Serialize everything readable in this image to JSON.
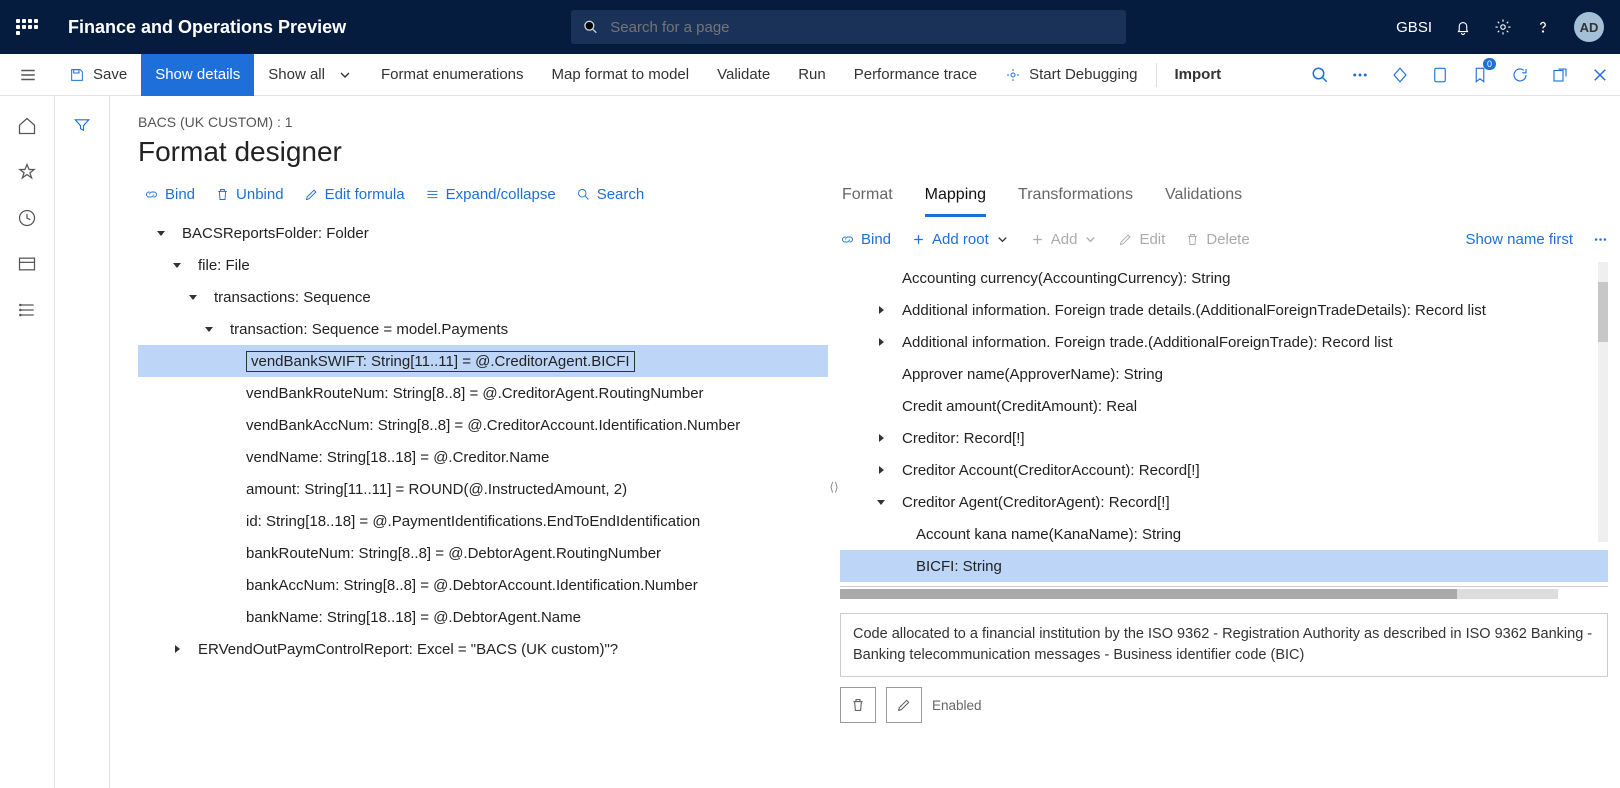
{
  "header": {
    "app_title": "Finance and Operations Preview",
    "search_placeholder": "Search for a page",
    "company": "GBSI",
    "avatar": "AD"
  },
  "cmdbar": {
    "save": "Save",
    "show_details": "Show details",
    "show_all": "Show all",
    "format_enum": "Format enumerations",
    "map_format": "Map format to model",
    "validate": "Validate",
    "run": "Run",
    "perf_trace": "Performance trace",
    "start_debug": "Start Debugging",
    "import": "Import",
    "badge": "0"
  },
  "page": {
    "crumb": "BACS (UK CUSTOM) : 1",
    "title": "Format designer"
  },
  "left_toolbar": {
    "bind": "Bind",
    "unbind": "Unbind",
    "edit_formula": "Edit formula",
    "expand": "Expand/collapse",
    "search": "Search"
  },
  "left_tree": [
    {
      "indent": 0,
      "expand": "down",
      "label": "BACSReportsFolder: Folder"
    },
    {
      "indent": 1,
      "expand": "down",
      "label": "file: File"
    },
    {
      "indent": 2,
      "expand": "down",
      "label": "transactions: Sequence"
    },
    {
      "indent": 3,
      "expand": "down",
      "label": "transaction: Sequence = model.Payments"
    },
    {
      "indent": 4,
      "expand": "",
      "label": "vendBankSWIFT: String[11..11] = @.CreditorAgent.BICFI",
      "selected": true
    },
    {
      "indent": 4,
      "expand": "",
      "label": "vendBankRouteNum: String[8..8] = @.CreditorAgent.RoutingNumber"
    },
    {
      "indent": 4,
      "expand": "",
      "label": "vendBankAccNum: String[8..8] = @.CreditorAccount.Identification.Number"
    },
    {
      "indent": 4,
      "expand": "",
      "label": "vendName: String[18..18] = @.Creditor.Name"
    },
    {
      "indent": 4,
      "expand": "",
      "label": "amount: String[11..11] = ROUND(@.InstructedAmount, 2)"
    },
    {
      "indent": 4,
      "expand": "",
      "label": "id: String[18..18] = @.PaymentIdentifications.EndToEndIdentification"
    },
    {
      "indent": 4,
      "expand": "",
      "label": "bankRouteNum: String[8..8] = @.DebtorAgent.RoutingNumber"
    },
    {
      "indent": 4,
      "expand": "",
      "label": "bankAccNum: String[8..8] = @.DebtorAccount.Identification.Number"
    },
    {
      "indent": 4,
      "expand": "",
      "label": "bankName: String[18..18] = @.DebtorAgent.Name"
    },
    {
      "indent": 1,
      "expand": "right",
      "label": "ERVendOutPaymControlReport: Excel = \"BACS (UK custom)\"?"
    }
  ],
  "right_tabs": {
    "format": "Format",
    "mapping": "Mapping",
    "transformations": "Transformations",
    "validations": "Validations"
  },
  "right_toolbar": {
    "bind": "Bind",
    "add_root": "Add root",
    "add": "Add",
    "edit": "Edit",
    "delete": "Delete",
    "show_name_first": "Show name first"
  },
  "right_tree": [
    {
      "indent": 0,
      "expand": "",
      "label": "Accounting currency(AccountingCurrency): String"
    },
    {
      "indent": 0,
      "expand": "right",
      "label": "Additional information. Foreign trade details.(AdditionalForeignTradeDetails): Record list"
    },
    {
      "indent": 0,
      "expand": "right",
      "label": "Additional information. Foreign trade.(AdditionalForeignTrade): Record list"
    },
    {
      "indent": 0,
      "expand": "",
      "label": "Approver name(ApproverName): String"
    },
    {
      "indent": 0,
      "expand": "",
      "label": "Credit amount(CreditAmount): Real"
    },
    {
      "indent": 0,
      "expand": "right",
      "label": "Creditor: Record[!]"
    },
    {
      "indent": 0,
      "expand": "right",
      "label": "Creditor Account(CreditorAccount): Record[!]"
    },
    {
      "indent": 0,
      "expand": "down",
      "label": "Creditor Agent(CreditorAgent): Record[!]"
    },
    {
      "indent": 1,
      "expand": "",
      "label": "Account kana name(KanaName): String"
    },
    {
      "indent": 1,
      "expand": "",
      "label": "BICFI: String",
      "selected": true
    }
  ],
  "description": "Code allocated to a financial institution by the ISO 9362 - Registration Authority as described in ISO 9362 Banking - Banking telecommunication messages - Business identifier code (BIC)",
  "enabled_label": "Enabled"
}
